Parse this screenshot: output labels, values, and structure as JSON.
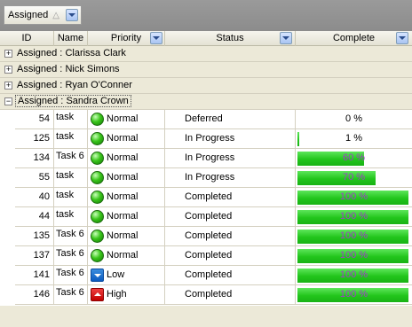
{
  "group_panel": {
    "label": "Assigned"
  },
  "columns": [
    "ID",
    "Name",
    "Priority",
    "Status",
    "Complete"
  ],
  "groups": [
    {
      "prefix": "Assigned :",
      "name": "Clarissa Clark",
      "expander": "+"
    },
    {
      "prefix": "Assigned :",
      "name": "Nick Simons",
      "expander": "+"
    },
    {
      "prefix": "Assigned :",
      "name": "Ryan O'Conner",
      "expander": "+"
    },
    {
      "prefix": "Assigned :",
      "name": "Sandra Crown",
      "expander": "−"
    }
  ],
  "rows": [
    {
      "id": "54",
      "name": "task",
      "priority": "Normal",
      "status": "Deferred",
      "complete": 0,
      "complete_label": "0 %"
    },
    {
      "id": "125",
      "name": "task",
      "priority": "Normal",
      "status": "In Progress",
      "complete": 1,
      "complete_label": "1 %"
    },
    {
      "id": "134",
      "name": "Task 6",
      "priority": "Normal",
      "status": "In Progress",
      "complete": 60,
      "complete_label": "60 %"
    },
    {
      "id": "55",
      "name": "task",
      "priority": "Normal",
      "status": "In Progress",
      "complete": 70,
      "complete_label": "70 %"
    },
    {
      "id": "40",
      "name": "task",
      "priority": "Normal",
      "status": "Completed",
      "complete": 100,
      "complete_label": "100 %"
    },
    {
      "id": "44",
      "name": "task",
      "priority": "Normal",
      "status": "Completed",
      "complete": 100,
      "complete_label": "100 %"
    },
    {
      "id": "135",
      "name": "Task 6",
      "priority": "Normal",
      "status": "Completed",
      "complete": 100,
      "complete_label": "100 %"
    },
    {
      "id": "137",
      "name": "Task 6",
      "priority": "Normal",
      "status": "Completed",
      "complete": 100,
      "complete_label": "100 %"
    },
    {
      "id": "141",
      "name": "Task 6",
      "priority": "Low",
      "status": "Completed",
      "complete": 100,
      "complete_label": "100 %"
    },
    {
      "id": "146",
      "name": "Task 6",
      "priority": "High",
      "status": "Completed",
      "complete": 100,
      "complete_label": "100 %"
    }
  ],
  "colors": {
    "bar_fill": "#22c51c",
    "bar_text": "#a03cc8",
    "priority_normal": "#39c51a",
    "priority_low": "#0b5bc0",
    "priority_high": "#c00000"
  }
}
